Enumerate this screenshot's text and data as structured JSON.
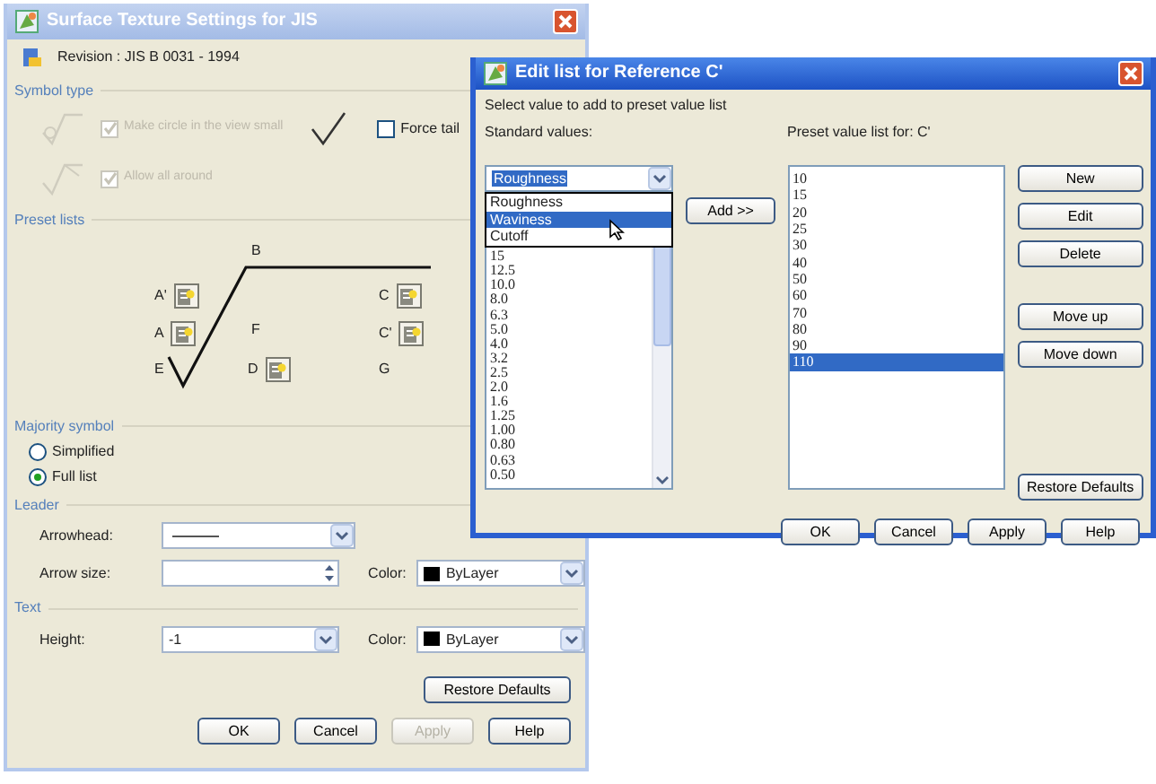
{
  "main_window": {
    "title": "Surface Texture Settings for JIS",
    "revision": "Revision : JIS B 0031 - 1994",
    "symbol_type": {
      "label": "Symbol type",
      "options": [
        {
          "label": "Make circle in the view small",
          "checked": true,
          "disabled": true
        },
        {
          "label": "Allow all around",
          "checked": true,
          "disabled": true
        }
      ],
      "force_tail": {
        "label": "Force tail",
        "checked": false
      }
    },
    "preset_lists": {
      "label": "Preset lists",
      "positions": [
        {
          "label": "B",
          "kind": "plain"
        },
        {
          "label": "A'",
          "kind": "button"
        },
        {
          "label": "C",
          "kind": "button"
        },
        {
          "label": "A",
          "kind": "button"
        },
        {
          "label": "F",
          "kind": "plain"
        },
        {
          "label": "C'",
          "kind": "button"
        },
        {
          "label": "E",
          "kind": "plain"
        },
        {
          "label": "D",
          "kind": "button"
        },
        {
          "label": "G",
          "kind": "plain"
        }
      ]
    },
    "majority_symbol": {
      "label": "Majority symbol",
      "options": [
        {
          "label": "Simplified",
          "selected": false
        },
        {
          "label": "Full list",
          "selected": true
        }
      ]
    },
    "leader": {
      "label": "Leader",
      "arrowhead": {
        "label": "Arrowhead:"
      },
      "arrow_size": {
        "label": "Arrow size:"
      },
      "color": {
        "label": "Color:",
        "value": "ByLayer"
      }
    },
    "text": {
      "label": "Text",
      "height": {
        "label": "Height:",
        "value": "-1"
      },
      "color": {
        "label": "Color:",
        "value": "ByLayer"
      }
    },
    "restore_button": "Restore Defaults",
    "buttons": [
      {
        "label": "OK",
        "disabled": false
      },
      {
        "label": "Cancel",
        "disabled": false
      },
      {
        "label": "Apply",
        "disabled": true
      },
      {
        "label": "Help",
        "disabled": false
      }
    ]
  },
  "edit_window": {
    "title": "Edit list for Reference C'",
    "instruction": "Select value to add to preset value list",
    "standard_label": "Standard values:",
    "combo_value": "Roughness",
    "dropdown_options": [
      {
        "label": "Roughness",
        "selected": false
      },
      {
        "label": "Waviness",
        "selected": true
      },
      {
        "label": "Cutoff",
        "selected": false
      }
    ],
    "standard_values": [
      "15",
      "12.5",
      "10.0",
      "8.0",
      "6.3",
      "5.0",
      "4.0",
      "3.2",
      "2.5",
      "2.0",
      "1.6",
      "1.25",
      "1.00",
      "0.80",
      "0.63",
      "0.50"
    ],
    "add_button": "Add >>",
    "preset_label": "Preset value list for: C'",
    "preset_values": [
      {
        "label": "10",
        "selected": false
      },
      {
        "label": "15",
        "selected": false
      },
      {
        "label": "20",
        "selected": false
      },
      {
        "label": "25",
        "selected": false
      },
      {
        "label": "30",
        "selected": false
      },
      {
        "label": "40",
        "selected": false
      },
      {
        "label": "50",
        "selected": false
      },
      {
        "label": "60",
        "selected": false
      },
      {
        "label": "70",
        "selected": false
      },
      {
        "label": "80",
        "selected": false
      },
      {
        "label": "90",
        "selected": false
      },
      {
        "label": "110",
        "selected": true
      }
    ],
    "side_buttons": [
      "New",
      "Edit",
      "Delete",
      "Move up",
      "Move down"
    ],
    "restore_button": "Restore Defaults",
    "buttons": [
      "OK",
      "Cancel",
      "Apply",
      "Help"
    ]
  }
}
